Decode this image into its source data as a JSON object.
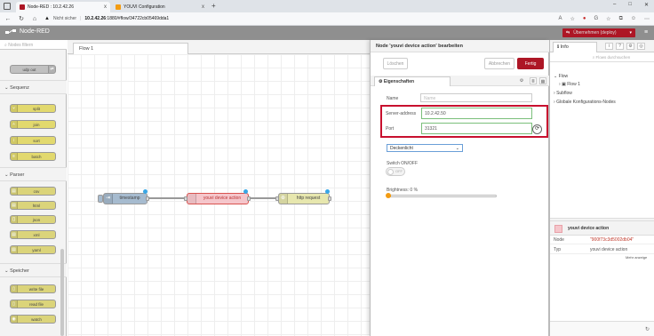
{
  "browser": {
    "tabs": [
      {
        "title": "Node-RED : 10.2.42.26",
        "color": "#ad1625"
      },
      {
        "title": "YOUVI Configuration",
        "color": "#f39c12"
      }
    ],
    "new_tab_symbol": "+",
    "close_symbol": "x",
    "url_warning": "Nicht sicher",
    "url_host": "10.2.42.26",
    "url_rest": ":1880/#flow/34722cb05469dda1",
    "win_controls": [
      "–",
      "□",
      "✕"
    ]
  },
  "nodered": {
    "logo_text": "Node-RED",
    "deploy_label": "Übernehmen (deploy)",
    "deploy_caret": "▾",
    "menu_symbol": "≡",
    "accent": "#ad1625"
  },
  "palette": {
    "search_placeholder": "Nodes filtern",
    "top_node": "udp out",
    "categories": {
      "sequence": "Sequenz",
      "parser": "Parser",
      "storage": "Speicher"
    },
    "sequence_nodes": [
      "split",
      "join",
      "sort",
      "batch"
    ],
    "parser_nodes": [
      "csv",
      "html",
      "json",
      "xml",
      "yaml"
    ],
    "storage_nodes": [
      "write file",
      "read file",
      "watch"
    ]
  },
  "workspace": {
    "tab_label": "Flow 1",
    "nodes": {
      "timestamp": "timestamp",
      "youvi": "youvi device action",
      "http": "http request"
    },
    "colors": {
      "inject": "#a6bbcf",
      "youvi": "#f5c6cb",
      "http": "#e7e7ae",
      "status_dot": "#39a7e6"
    }
  },
  "tray": {
    "title": "Node 'youvi device action' bearbeiten",
    "delete_label": "Löschen",
    "cancel_label": "Abbrechen",
    "done_label": "Fertig",
    "props_tab": "Eigenschaften",
    "name_label": "Name",
    "name_placeholder": "Name",
    "server_label": "Server-address",
    "server_value": "10.2.42.50",
    "port_label": "Port",
    "port_value": "31321",
    "select_value": "Deckenlicht",
    "switch_label": "Switch ON/OFF",
    "switch_text": "OFF",
    "brightness_label": "Brightness: 0 %",
    "brightness_value": 0
  },
  "sidebar": {
    "tab_label": "Info",
    "search_placeholder": "Flows durchsuchen",
    "tree": {
      "flow": "Flow",
      "flow1": "Flow 1",
      "subflow": "Subflow",
      "global": "Globale Konfigurations-Nodes"
    },
    "node": {
      "name": "youvi device action",
      "rows": [
        {
          "key": "Node",
          "value": "\"900f73c3d5002db04\""
        },
        {
          "key": "Typ",
          "value": "youvi device action"
        }
      ],
      "more": "Mehr anzeige"
    }
  }
}
